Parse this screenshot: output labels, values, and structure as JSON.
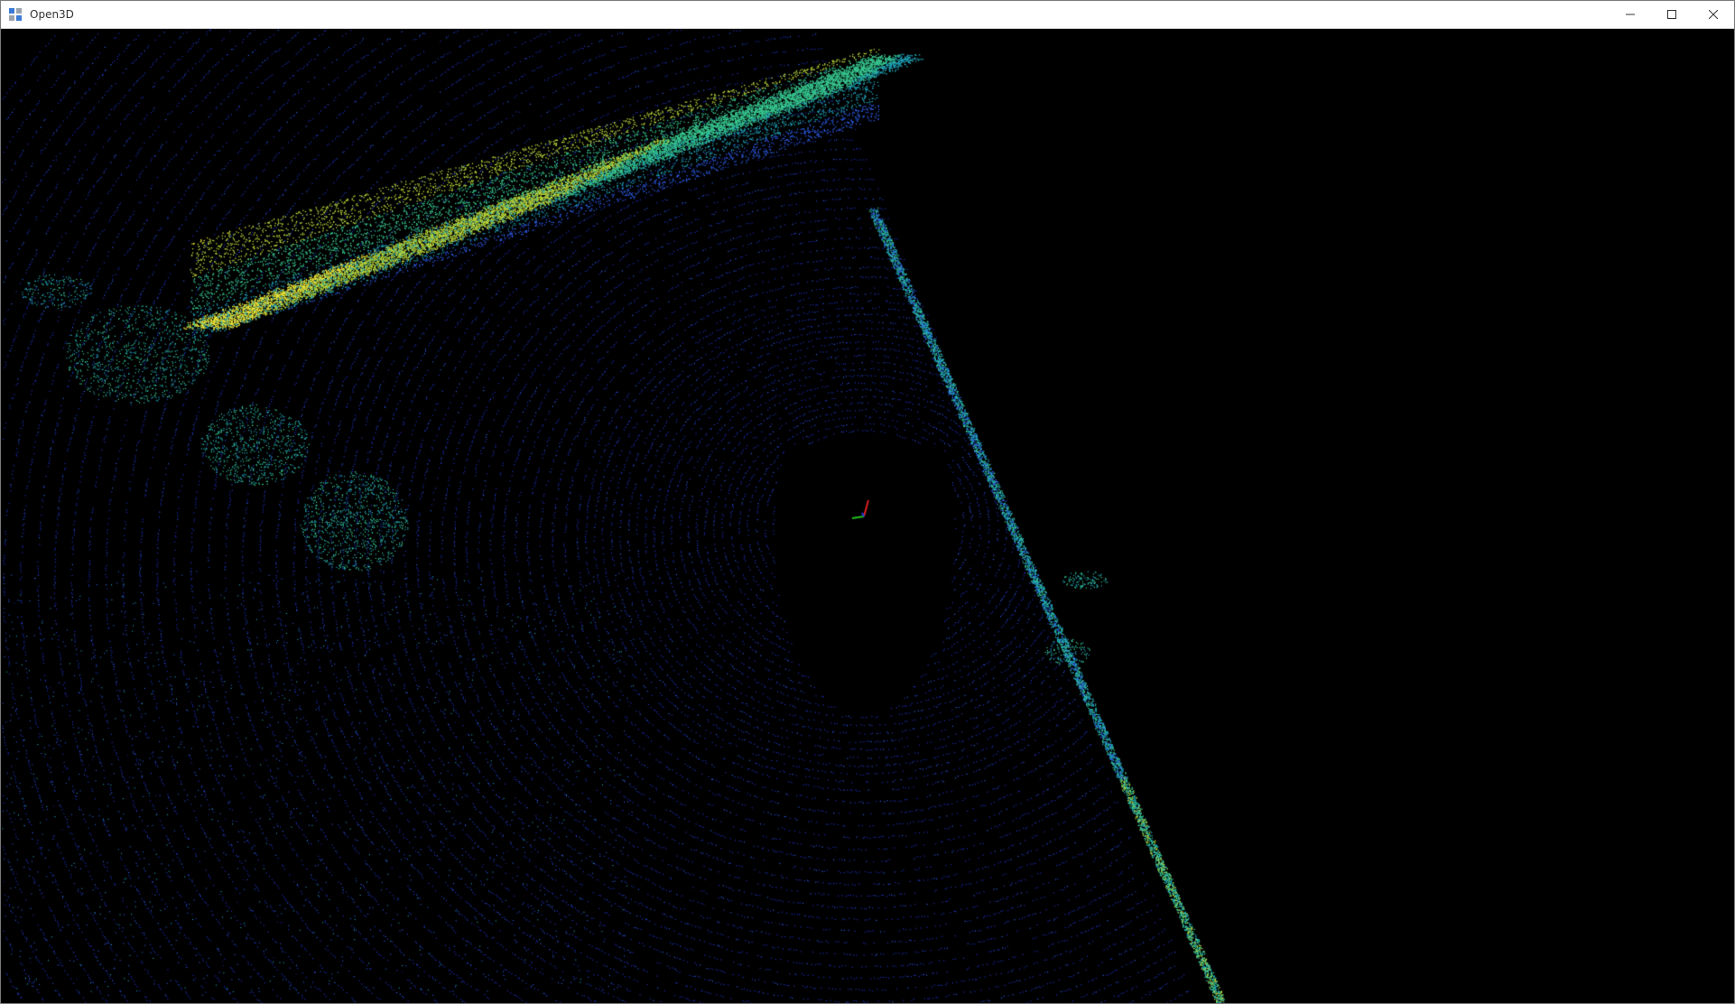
{
  "window": {
    "title": "Open3D",
    "controls": {
      "minimize_icon": "minimize-icon",
      "maximize_icon": "maximize-icon",
      "close_icon": "close-icon"
    }
  },
  "viewport": {
    "background": "#000000",
    "content": "point-cloud",
    "colormap": [
      "#1a1a8c",
      "#2d5be0",
      "#1fa3b8",
      "#38c790",
      "#b7d43a",
      "#e6e33a"
    ],
    "axes": {
      "x_color": "#e02020",
      "y_color": "#20c020",
      "z_color": "#2040e0"
    }
  }
}
